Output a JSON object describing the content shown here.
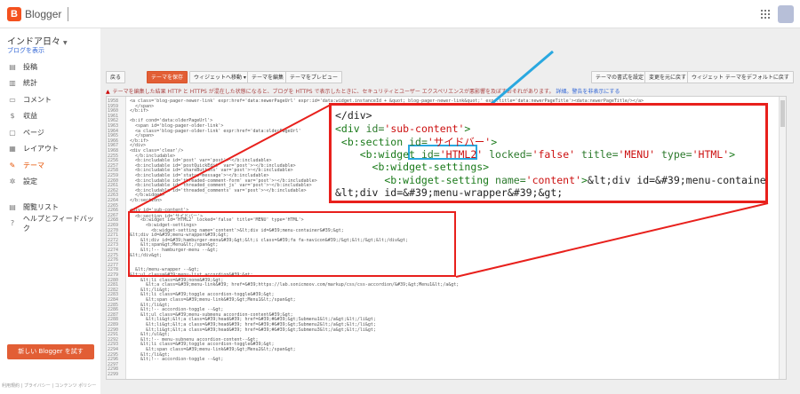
{
  "app": {
    "brand": "Blogger",
    "logo_letter": "B"
  },
  "sidebar": {
    "blog_name": "インドア日々",
    "view_blog": "ブログを表示",
    "items": [
      {
        "label": "投稿",
        "icon": "posts-icon",
        "glyph": "▤"
      },
      {
        "label": "統計",
        "icon": "stats-icon",
        "glyph": "▥"
      },
      {
        "label": "コメント",
        "icon": "comment-icon",
        "glyph": "▭"
      },
      {
        "label": "収益",
        "icon": "dollar-icon",
        "glyph": "$"
      },
      {
        "label": "ページ",
        "icon": "page-icon",
        "glyph": "▢"
      },
      {
        "label": "レイアウト",
        "icon": "layout-icon",
        "glyph": "▦"
      },
      {
        "label": "テーマ",
        "icon": "theme-icon",
        "glyph": "✎",
        "active": true
      },
      {
        "label": "設定",
        "icon": "gear-icon",
        "glyph": "✲"
      }
    ],
    "secondary": [
      {
        "label": "閲覧リスト",
        "icon": "reading-list-icon",
        "glyph": "▤"
      },
      {
        "label": "ヘルプとフィードバック",
        "icon": "help-icon",
        "glyph": "?"
      }
    ],
    "try_button": "新しい Blogger を試す",
    "footer": "利用規約 | プライバシー | コンテンツ ポリシー"
  },
  "toolbar": {
    "back": "戻る",
    "save": "テーマを保存",
    "jump": "ウィジェットへ移動 ▾",
    "edit": "テーマを編集",
    "preview": "テーマをプレビュー",
    "format": "テーマの書式を設定",
    "revert": "変更を元に戻す",
    "reset_widgets": "ウィジェット テーマをデフォルトに戻す"
  },
  "warning": {
    "text": "テーマを編集した結果 HTTP と HTTPS が混在した状態になると、ブログを HTTPS で表示したときに、セキュリティとユーザー エクスペリエンスが悪影響を及ぼすおそれがあります。",
    "link": "詳細。警告を非表示にする"
  },
  "editor": {
    "line_numbers": [
      "1958",
      "1959",
      "1960",
      "1961",
      "1962",
      "1963",
      "1964",
      "1965",
      "1966",
      "1967",
      "1968",
      "2255",
      "2256",
      "2257",
      "2258",
      "2259",
      "2260",
      "2261",
      "2262",
      "2263",
      "2264",
      "2265",
      "2266",
      "2267",
      "2268",
      "2269",
      "2270",
      "2271",
      "2272",
      "2273",
      "2274",
      "2275",
      "2276",
      "2277",
      "2278",
      "2279",
      "2280",
      "2281",
      "2282",
      "2283",
      "2284",
      "2285",
      "2286",
      "2287",
      "2288",
      "2289",
      "2290",
      "2291",
      "2292",
      "2293",
      "2294",
      "2295",
      "2296",
      "2297",
      "2298",
      "2299"
    ],
    "lines": [
      "<a class='blog-pager-newer-link' expr:href='data:newerPageUrl' expr:id='data:widget.instanceId + &quot;_blog-pager-newer-link&quot;' expr:title='data:newerPageTitle'><data:newerPageTitle/></a>",
      "  </span>",
      "</b:if>",
      "",
      "<b:if cond='data:olderPageUrl'>",
      "  <span id='blog-pager-older-link'>",
      "  <a class='blog-pager-older-link' expr:href='data:olderPageUrl'",
      "  </span>",
      "</b:if>",
      "</div>",
      "<div class='clear'/>",
      "  </b:includable>",
      "  <b:includable id='post' var='post'>~</b:includable>",
      "  <b:includable id='postQuickEdit' var='post'>~</b:includable>",
      "  <b:includable id='shareButtons' var='post'>~</b:includable>",
      "  <b:includable id='status-message'>~</b:includable>",
      "  <b:includable id='threaded-comment-form' var='post'>~</b:includable>",
      "  <b:includable id='threaded_comment_js' var='post'>~</b:includable>",
      "  <b:includable id='threaded_comments' var='post'>~</b:includable>",
      "  </b:widget>",
      "</b:section>",
      "",
      "<div id='sub-content'>",
      "  <b:section id='サイドバー'>",
      "    <b:widget id='HTML2' locked='false' title='MENU' type='HTML'>",
      "      <b:widget-settings>",
      "        <b:widget-setting name='content'>&lt;div id=&#39;menu-container&#39;&gt;",
      "&lt;div id=&#39;menu-wrapper&#39;&gt;",
      "    &lt;div id=&#39;hamburger-menu&#39;&gt;&lt;i class=&#39;fa fa-navicon&#39;/&gt;&lt;/&gt;&lt;/div&gt;",
      "    &lt;span&gt;Menu&lt;/span&gt;",
      "    &lt;!-- hamburger-menu --&gt;",
      "&lt;/div&gt;",
      "",
      "",
      "  &lt;/menu-wrapper --&gt;",
      "&lt;ul class=&#39;menu-list accordion&#39;&gt;",
      "    &lt;li class=&#39;none&#39;&gt;",
      "      &lt;a class=&#39;menu-link&#39; href=&#39;https://lab.sonicmoov.com/markup/css/css-accordion/&#39;&gt;Menu1&lt;/a&gt;",
      "    &lt;/li&gt;",
      "    &lt;li class=&#39;toggle accordion-toggle&#39;&gt;",
      "      &lt;span class=&#39;menu-link&#39;&gt;Menu1&lt;/span&gt;",
      "    &lt;/li&gt;",
      "    &lt;!-- accordion-toggle --&gt;",
      "    &lt;ul class=&#39;menu-submenu accordion-content&#39;&gt;",
      "      &lt;li&gt;&lt;a class=&#39;head&#39; href=&#39;#&#39;&gt;Submenu1&lt;/a&gt;&lt;/li&gt;",
      "      &lt;li&gt;&lt;a class=&#39;head&#39; href=&#39;#&#39;&gt;Submenu2&lt;/a&gt;&lt;/li&gt;",
      "      &lt;li&gt;&lt;a class=&#39;head&#39; href=&#39;#&#39;&gt;Submenu3&lt;/a&gt;&lt;/li&gt;",
      "    &lt;/ul&gt;",
      "    &lt;!-- menu-subnenu accordion-content--&gt;",
      "    &lt;li class=&#39;toggle accordion-toggle&#39;&gt;",
      "      &lt;span class=&#39;menu-link&#39;&gt;Menu2&lt;/span&gt;",
      "    &lt;/li&gt;",
      "    &lt;!-- accordion-toggle --&gt;",
      "",
      "",
      ""
    ]
  },
  "zoom": {
    "lines": [
      {
        "parts": [
          [
            "plain",
            "</div>"
          ]
        ]
      },
      {
        "parts": [
          [
            "tag",
            "<div "
          ],
          [
            "attr",
            "id="
          ],
          [
            "str",
            "'sub-content'"
          ],
          [
            "tag",
            ">"
          ]
        ]
      },
      {
        "parts": [
          [
            "tag",
            " <b:section "
          ],
          [
            "attr",
            "id="
          ],
          [
            "str",
            "'サイドバー'"
          ],
          [
            "tag",
            ">"
          ]
        ]
      },
      {
        "parts": [
          [
            "tag",
            "    <b:widget "
          ],
          [
            "attr",
            "id="
          ],
          [
            "str",
            "'HTML2'"
          ],
          [
            "attr",
            " locked="
          ],
          [
            "str",
            "'false'"
          ],
          [
            "attr",
            " title="
          ],
          [
            "str",
            "'MENU'"
          ],
          [
            "attr",
            " type="
          ],
          [
            "str",
            "'HTML'"
          ],
          [
            "tag",
            ">"
          ]
        ]
      },
      {
        "parts": [
          [
            "tag",
            "      <b:widget-settings>"
          ]
        ]
      },
      {
        "parts": [
          [
            "tag",
            "        <b:widget-setting "
          ],
          [
            "attr",
            "name="
          ],
          [
            "str",
            "'content'"
          ],
          [
            "tag",
            ">"
          ],
          [
            "plain",
            "&lt;div id=&#39;menu-container&"
          ]
        ]
      },
      {
        "parts": [
          [
            "plain",
            "&lt;div id=&#39;menu-wrapper&#39;&gt;"
          ]
        ]
      }
    ]
  },
  "colors": {
    "accent": "#e25e35",
    "annotation_red": "#e8201c",
    "annotation_blue": "#29a8e0"
  }
}
